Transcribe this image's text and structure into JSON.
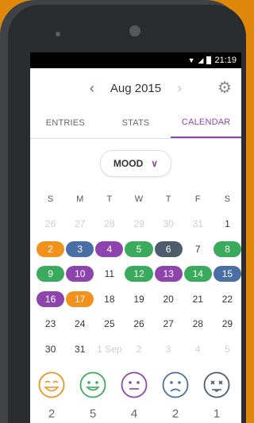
{
  "status": {
    "time": "21:19"
  },
  "toolbar": {
    "month_label": "Aug 2015",
    "prev_glyph": "‹",
    "next_glyph": "›",
    "settings_icon": "gear-icon"
  },
  "tabs": [
    {
      "label": "ENTRIES",
      "active": false
    },
    {
      "label": "STATS",
      "active": false
    },
    {
      "label": "CALENDAR",
      "active": true
    }
  ],
  "filter": {
    "selected": "MOOD"
  },
  "weekdays": [
    "S",
    "M",
    "T",
    "W",
    "T",
    "F",
    "S"
  ],
  "weeks": [
    [
      {
        "d": "26",
        "m": true
      },
      {
        "d": "27",
        "m": true
      },
      {
        "d": "28",
        "m": true
      },
      {
        "d": "29",
        "m": true
      },
      {
        "d": "30",
        "m": true
      },
      {
        "d": "31",
        "m": true
      },
      {
        "d": "1"
      }
    ],
    [
      {
        "d": "2",
        "c": "orange"
      },
      {
        "d": "3",
        "c": "blue"
      },
      {
        "d": "4",
        "c": "purple"
      },
      {
        "d": "5",
        "c": "green"
      },
      {
        "d": "6",
        "c": "slate"
      },
      {
        "d": "7"
      },
      {
        "d": "8",
        "c": "green"
      }
    ],
    [
      {
        "d": "9",
        "c": "green"
      },
      {
        "d": "10",
        "c": "purple"
      },
      {
        "d": "11"
      },
      {
        "d": "12",
        "c": "green"
      },
      {
        "d": "13",
        "c": "purple"
      },
      {
        "d": "14",
        "c": "green"
      },
      {
        "d": "15",
        "c": "blue"
      }
    ],
    [
      {
        "d": "16",
        "c": "purple"
      },
      {
        "d": "17",
        "c": "orange"
      },
      {
        "d": "18"
      },
      {
        "d": "19"
      },
      {
        "d": "20"
      },
      {
        "d": "21"
      },
      {
        "d": "22"
      }
    ],
    [
      {
        "d": "23"
      },
      {
        "d": "24"
      },
      {
        "d": "25"
      },
      {
        "d": "26"
      },
      {
        "d": "27"
      },
      {
        "d": "28"
      },
      {
        "d": "29"
      }
    ],
    [
      {
        "d": "30"
      },
      {
        "d": "31"
      },
      {
        "d": "1 Sep",
        "m": true
      },
      {
        "d": "2",
        "m": true
      },
      {
        "d": "3",
        "m": true
      },
      {
        "d": "4",
        "m": true
      },
      {
        "d": "5",
        "m": true
      }
    ]
  ],
  "moods": [
    {
      "name": "ecstatic-face-icon",
      "color": "#f0921b",
      "count": "2"
    },
    {
      "name": "happy-face-icon",
      "color": "#3aaa5c",
      "count": "5"
    },
    {
      "name": "neutral-face-icon",
      "color": "#8e44ad",
      "count": "4"
    },
    {
      "name": "sad-face-icon",
      "color": "#4a6fa5",
      "count": "2"
    },
    {
      "name": "awful-face-icon",
      "color": "#4e5d6c",
      "count": "1"
    }
  ],
  "colors": {
    "accent": "#8e44ad",
    "orange": "#f0921b",
    "green": "#3aaa5c",
    "blue": "#4a6fa5",
    "slate": "#4e5d6c"
  }
}
